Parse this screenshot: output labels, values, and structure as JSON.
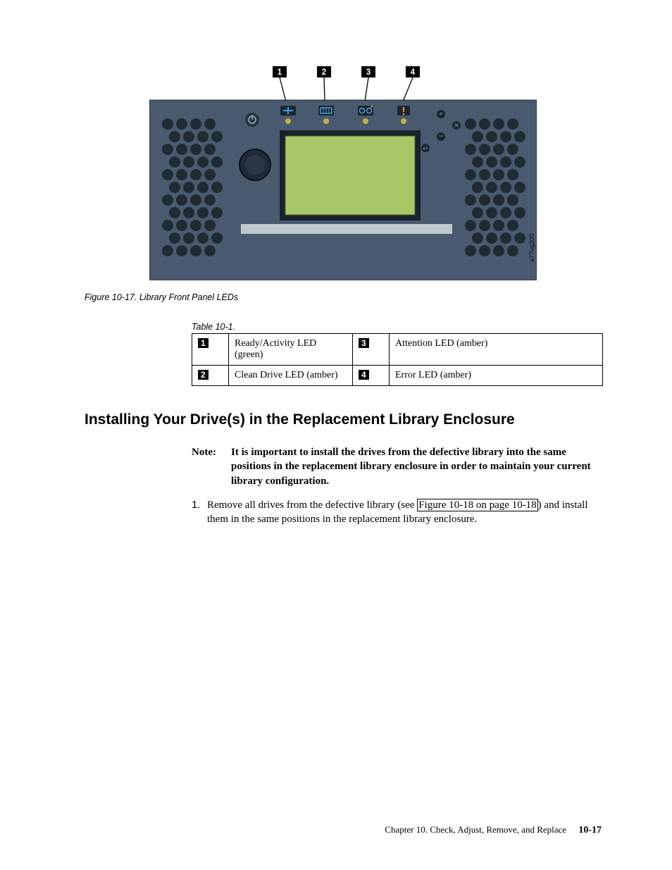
{
  "figure": {
    "caption": "Figure 10-17. Library Front Panel LEDs",
    "callouts": [
      "1",
      "2",
      "3",
      "4"
    ],
    "side_label": "a77ug200"
  },
  "table": {
    "caption": "Table 10-1.",
    "rows": [
      {
        "num_a": "1",
        "desc_a": "Ready/Activity LED (green)",
        "num_b": "3",
        "desc_b": "Attention LED (amber)"
      },
      {
        "num_a": "2",
        "desc_a": "Clean Drive LED (amber)",
        "num_b": "4",
        "desc_b": "Error LED (amber)"
      }
    ]
  },
  "heading": "Installing Your Drive(s) in the Replacement Library Enclosure",
  "note": {
    "label": "Note:",
    "text": "It is important to install the drives from the defective library into the same positions in the replacement library enclosure in order to maintain your current library configuration."
  },
  "step": {
    "num": "1.",
    "text_before": "Remove all drives from the defective library (see ",
    "link": "Figure 10-18 on page 10-18",
    "text_after": ") and install them in the same positions in the replacement library enclosure."
  },
  "footer": {
    "chapter": "Chapter 10. Check, Adjust, Remove, and Replace",
    "page": "10-17"
  }
}
